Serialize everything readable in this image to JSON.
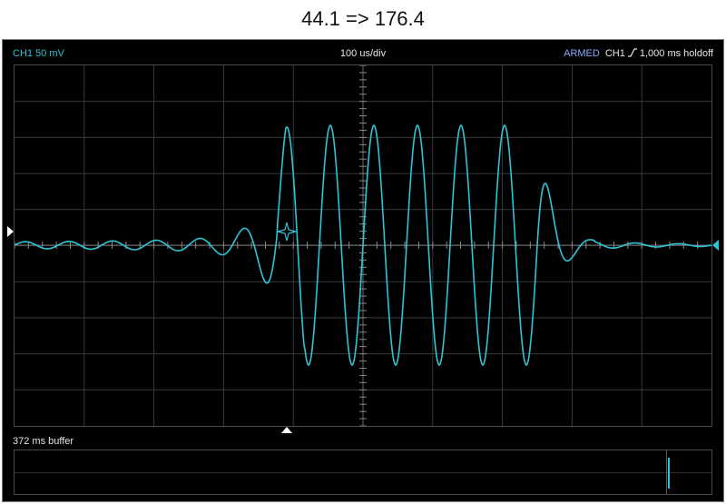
{
  "title": "44.1 => 176.4",
  "header": {
    "channel_scale": "CH1 50 mV",
    "timebase": "100 us/div",
    "status": "ARMED",
    "trigger_channel": "CH1",
    "holdoff": "1,000 ms holdoff"
  },
  "buffer": {
    "label": "372 ms buffer"
  },
  "icons": {
    "trigger_slope": "rising-edge-icon",
    "trigger_point": "crosshair-diamond-icon",
    "trigger_level_marker": "left-triangle-icon",
    "ground_level_marker": "right-triangle-icon",
    "trigger_position_marker": "up-triangle-icon"
  },
  "colors": {
    "background": "#000000",
    "trace": "#2fc5d6",
    "grid": "#3a3a3a",
    "status": "#8fa8ff"
  }
}
